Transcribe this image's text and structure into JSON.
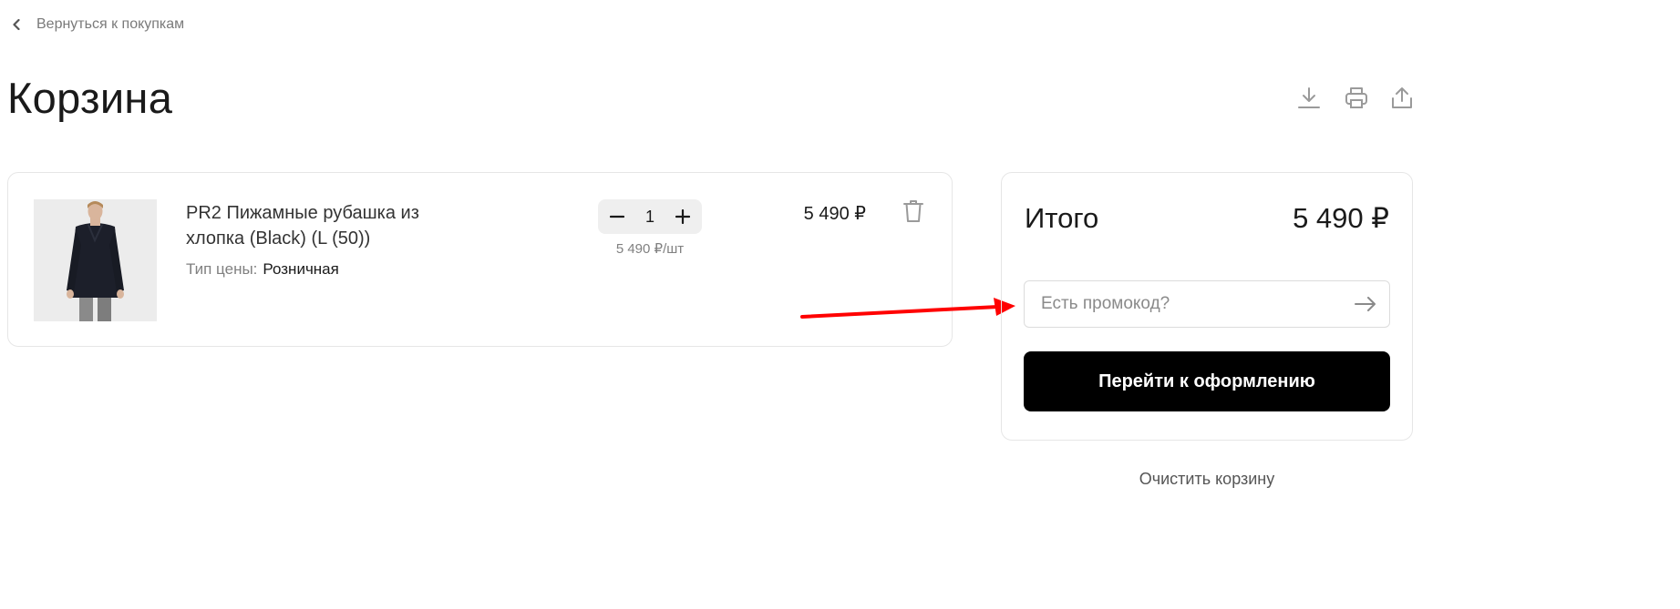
{
  "nav": {
    "back_label": "Вернуться к покупкам",
    "back_icon": "chevron-left-icon"
  },
  "page": {
    "title": "Корзина"
  },
  "toolbar": {
    "icons": [
      "download-icon",
      "print-icon",
      "share-icon"
    ]
  },
  "cart": {
    "items": [
      {
        "name": "PR2 Пижамные рубашка из хлопка (Black) (L (50))",
        "price_type_label": "Тип цены:",
        "price_type_value": "Розничная",
        "quantity": "1",
        "unit_price": "5 490 ₽/шт",
        "price": "5 490 ₽"
      }
    ]
  },
  "summary": {
    "total_label": "Итого",
    "total_value": "5 490 ₽",
    "promo_placeholder": "Есть промокод?",
    "checkout_label": "Перейти к оформлению",
    "clear_label": "Очистить корзину"
  },
  "colors": {
    "accent": "#000000",
    "annotation_arrow": "#ff0000",
    "muted_text": "#808080",
    "border": "#e6e6e6"
  }
}
